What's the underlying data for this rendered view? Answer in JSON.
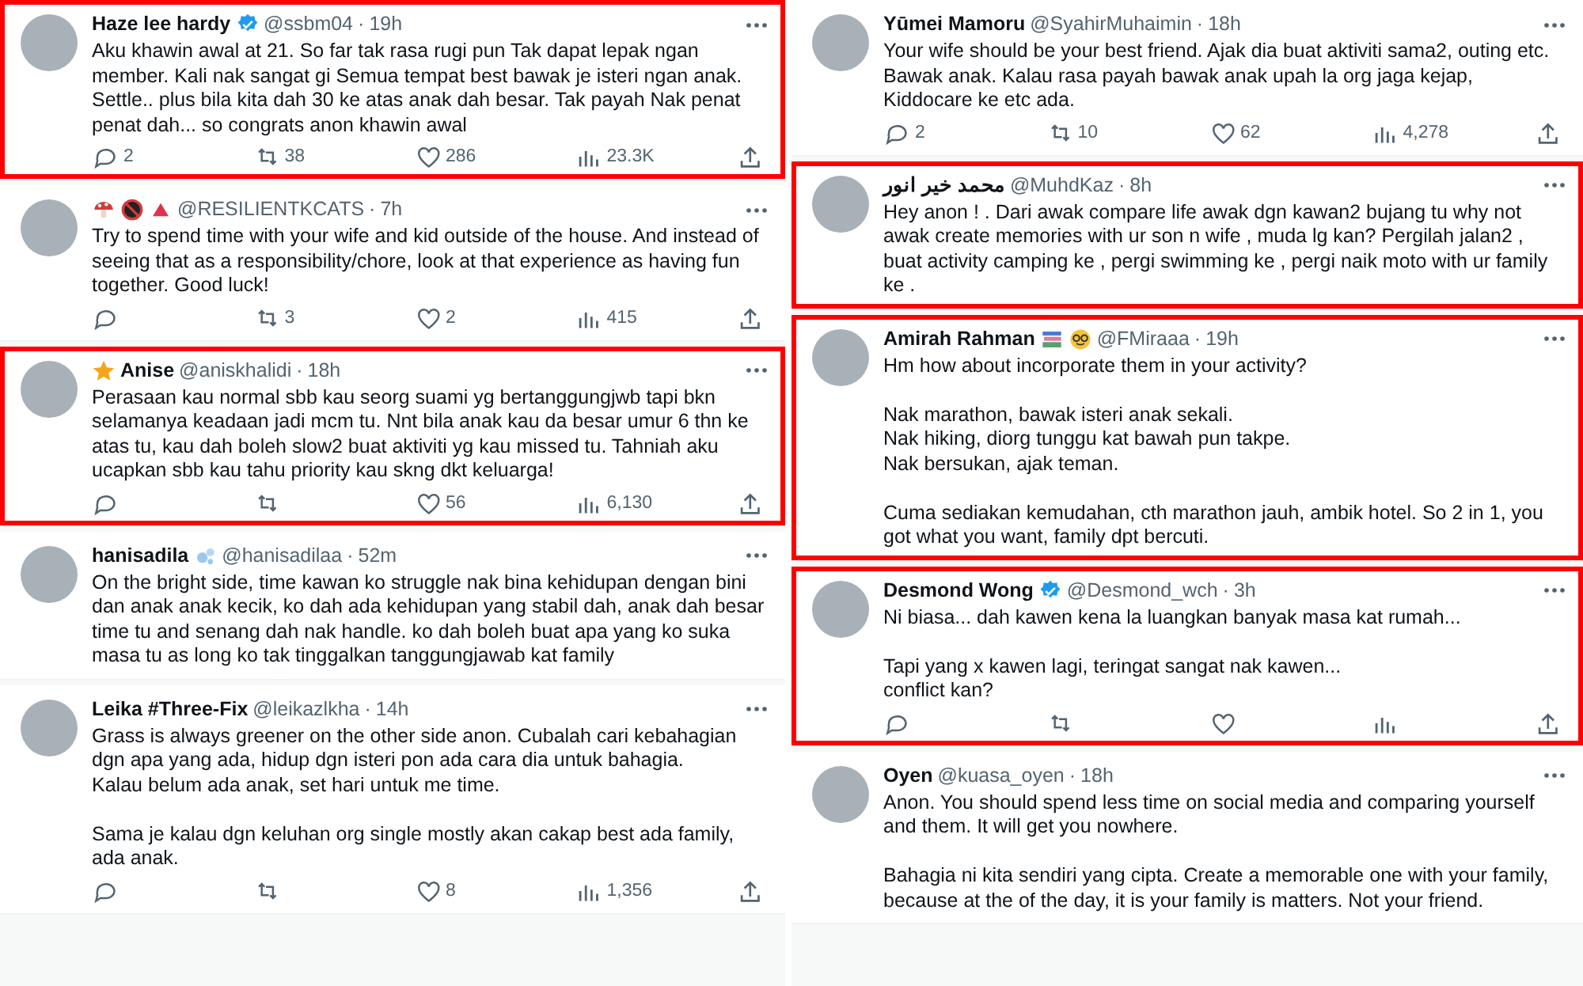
{
  "columns": [
    {
      "tweets": [
        {
          "name": "Haze lee hardy",
          "badge": {
            "kind": "verified"
          },
          "handle": "@ssbm04",
          "separator": "·",
          "time": "19h",
          "highlighted": true,
          "text": "Aku khawin awal at 21. So far tak rasa rugi pun Tak dapat lepak ngan member. Kali nak sangat gi Semua tempat best bawak je isteri ngan anak. Settle.. plus bila kita dah 30 ke atas anak dah besar. Tak payah Nak penat penat dah... so congrats anon khawin awal",
          "stats": [
            {
              "kind": "reply",
              "count": "2"
            },
            {
              "kind": "repost",
              "count": "38"
            },
            {
              "kind": "like",
              "count": "286"
            },
            {
              "kind": "views",
              "count": "23.3K"
            },
            {
              "kind": "share"
            }
          ]
        },
        {
          "name_icons": [
            {
              "kind": "mushroom"
            },
            {
              "kind": "prohibited"
            },
            {
              "kind": "triangle"
            }
          ],
          "handle": "@RESILIENTKCATS",
          "separator": "·",
          "time": "7h",
          "highlighted": false,
          "text": "Try to spend time with your wife and kid outside of the house. And instead of seeing that as a responsibility/chore, look at that experience as having fun together. Good luck!",
          "stats": [
            {
              "kind": "reply"
            },
            {
              "kind": "repost",
              "count": "3"
            },
            {
              "kind": "like",
              "count": "2"
            },
            {
              "kind": "views",
              "count": "415"
            },
            {
              "kind": "share"
            }
          ]
        },
        {
          "badge": {
            "kind": "star"
          },
          "name": "Anise",
          "handle": "@aniskhalidi",
          "separator": "·",
          "time": "18h",
          "highlighted": true,
          "text": "Perasaan kau normal sbb kau seorg suami yg bertanggungjwb tapi bkn selamanya keadaan jadi mcm tu. Nnt bila anak kau da besar umur 6 thn ke atas tu, kau dah boleh slow2 buat aktiviti yg kau missed tu. Tahniah aku ucapkan sbb kau tahu priority kau skng dkt keluarga!",
          "stats": [
            {
              "kind": "reply"
            },
            {
              "kind": "repost"
            },
            {
              "kind": "like",
              "count": "56"
            },
            {
              "kind": "views",
              "count": "6,130"
            },
            {
              "kind": "share"
            }
          ]
        },
        {
          "name": "hanisadila",
          "name_icons": [
            {
              "kind": "bubbles"
            }
          ],
          "handle": "@hanisadilaa",
          "separator": "·",
          "time": "52m",
          "highlighted": false,
          "text": "On the bright side, time kawan ko struggle nak bina kehidupan dengan bini dan anak anak kecik, ko dah ada kehidupan yang stabil dah, anak dah besar time tu and senang dah nak handle. ko dah boleh buat apa yang ko suka masa tu as long ko tak tinggalkan tanggungjawab kat family"
        },
        {
          "name": "Leika #Three-Fix",
          "handle": "@leikazlkha",
          "separator": "·",
          "time": "14h",
          "highlighted": false,
          "text": "Grass is always greener on the other side anon. Cubalah cari kebahagian dgn apa yang ada, hidup dgn isteri pon ada cara dia untuk bahagia.\nKalau belum ada anak, set hari untuk me time.\n\nSama je kalau dgn keluhan org single mostly akan cakap best ada family, ada anak.",
          "stats": [
            {
              "kind": "reply"
            },
            {
              "kind": "repost"
            },
            {
              "kind": "like",
              "count": "8"
            },
            {
              "kind": "views",
              "count": "1,356"
            },
            {
              "kind": "share"
            }
          ]
        }
      ]
    },
    {
      "tweets": [
        {
          "name": "Yūmei Mamoru",
          "handle": "@SyahirMuhaimin",
          "separator": "·",
          "time": "18h",
          "highlighted": false,
          "text": "Your wife should be your best friend. Ajak dia buat aktiviti sama2, outing etc. Bawak anak. Kalau rasa payah bawak anak upah la org jaga kejap, Kiddocare ke etc ada.",
          "stats": [
            {
              "kind": "reply",
              "count": "2"
            },
            {
              "kind": "repost",
              "count": "10"
            },
            {
              "kind": "like",
              "count": "62"
            },
            {
              "kind": "views",
              "count": "4,278"
            },
            {
              "kind": "share"
            }
          ]
        },
        {
          "name": "محمد خير انور",
          "handle": "@MuhdKaz",
          "separator": "·",
          "time": "8h",
          "highlighted": true,
          "text": "Hey anon ! . Dari awak compare life awak dgn kawan2 bujang tu why not awak create memories with ur son n wife , muda lg kan? Pergilah jalan2 , buat activity camping ke , pergi swimming ke , pergi naik moto with ur family ke ."
        },
        {
          "name": "Amirah Rahman",
          "name_icons": [
            {
              "kind": "books"
            },
            {
              "kind": "nerd"
            }
          ],
          "handle": "@FMiraaa",
          "separator": "·",
          "time": "19h",
          "highlighted": true,
          "text": "Hm how about incorporate them in your activity?\n\nNak marathon, bawak isteri anak sekali.\nNak hiking, diorg tunggu kat bawah pun takpe.\nNak bersukan, ajak teman.\n\nCuma sediakan kemudahan, cth marathon jauh, ambik hotel. So 2 in 1, you got what you want, family dpt bercuti."
        },
        {
          "name": "Desmond Wong",
          "badge": {
            "kind": "verified"
          },
          "handle": "@Desmond_wch",
          "separator": "·",
          "time": "3h",
          "highlighted": true,
          "text": "Ni biasa... dah kawen kena la luangkan banyak masa kat rumah...\n\nTapi yang x kawen lagi, teringat sangat nak kawen...\nconflict kan?",
          "stats": [
            {
              "kind": "reply"
            },
            {
              "kind": "repost"
            },
            {
              "kind": "like"
            },
            {
              "kind": "views"
            },
            {
              "kind": "share"
            }
          ]
        },
        {
          "name": "Oyen",
          "handle": "@kuasa_oyen",
          "separator": "·",
          "time": "18h",
          "highlighted": false,
          "text": "Anon. You should spend less time on social media and comparing yourself and them. It will get you nowhere.\n\nBahagia ni kita sendiri yang cipta. Create a memorable one with your family, because at the of the day, it is your family is matters. Not your friend."
        }
      ]
    }
  ]
}
